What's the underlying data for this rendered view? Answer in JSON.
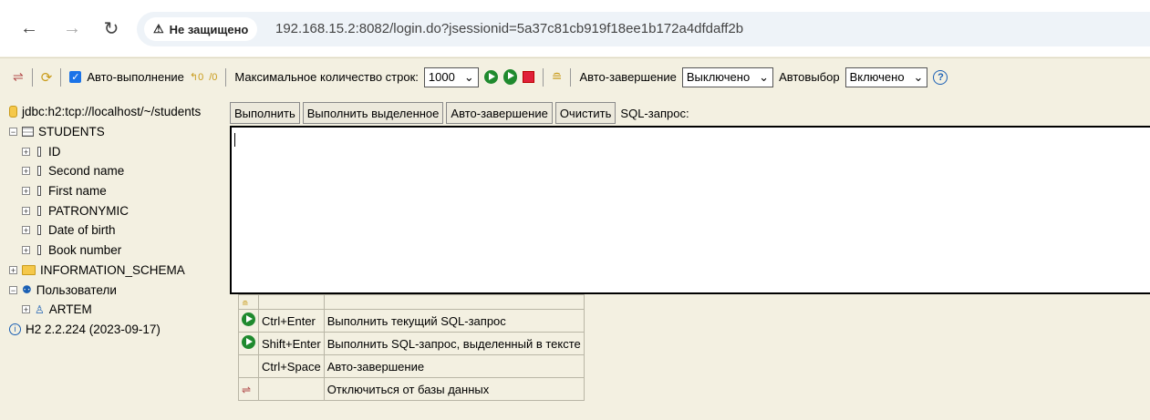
{
  "browser": {
    "back_icon": "arrow-left-icon",
    "forward_icon": "arrow-right-icon",
    "reload_icon": "reload-icon",
    "security_label": "Не защищено",
    "url": "192.168.15.2:8082/login.do?jsessionid=5a37c81cb919f18ee1b172a4dfdaff2b"
  },
  "toolbar": {
    "autoexec_label": "Авто-выполнение",
    "max_rows_label": "Максимальное количество строк:",
    "max_rows_value": "1000",
    "autocomplete_label": "Авто-завершение",
    "autocomplete_value": "Выключено",
    "autoselect_label": "Автовыбор",
    "autoselect_value": "Включено",
    "help_glyph": "?"
  },
  "tree": {
    "connection": "jdbc:h2:tcp://localhost/~/students",
    "table": "STUDENTS",
    "columns": [
      "ID",
      "Second name",
      "First name",
      "PATRONYMIC",
      "Date of birth",
      "Book number"
    ],
    "schema": "INFORMATION_SCHEMA",
    "users_label": "Пользователи",
    "user": "ARTEM",
    "version": "H2 2.2.224 (2023-09-17)"
  },
  "buttons": {
    "run": "Выполнить",
    "run_selected": "Выполнить выделенное",
    "autocomplete": "Авто-завершение",
    "clear": "Очистить",
    "sql_label": "SQL-запрос:"
  },
  "shortcuts": [
    {
      "key": "Ctrl+Enter",
      "desc": "Выполнить текущий SQL-запрос"
    },
    {
      "key": "Shift+Enter",
      "desc": "Выполнить SQL-запрос, выделенный в тексте"
    },
    {
      "key": "Ctrl+Space",
      "desc": "Авто-завершение"
    },
    {
      "key": "",
      "desc": "Отключиться от базы данных"
    }
  ]
}
